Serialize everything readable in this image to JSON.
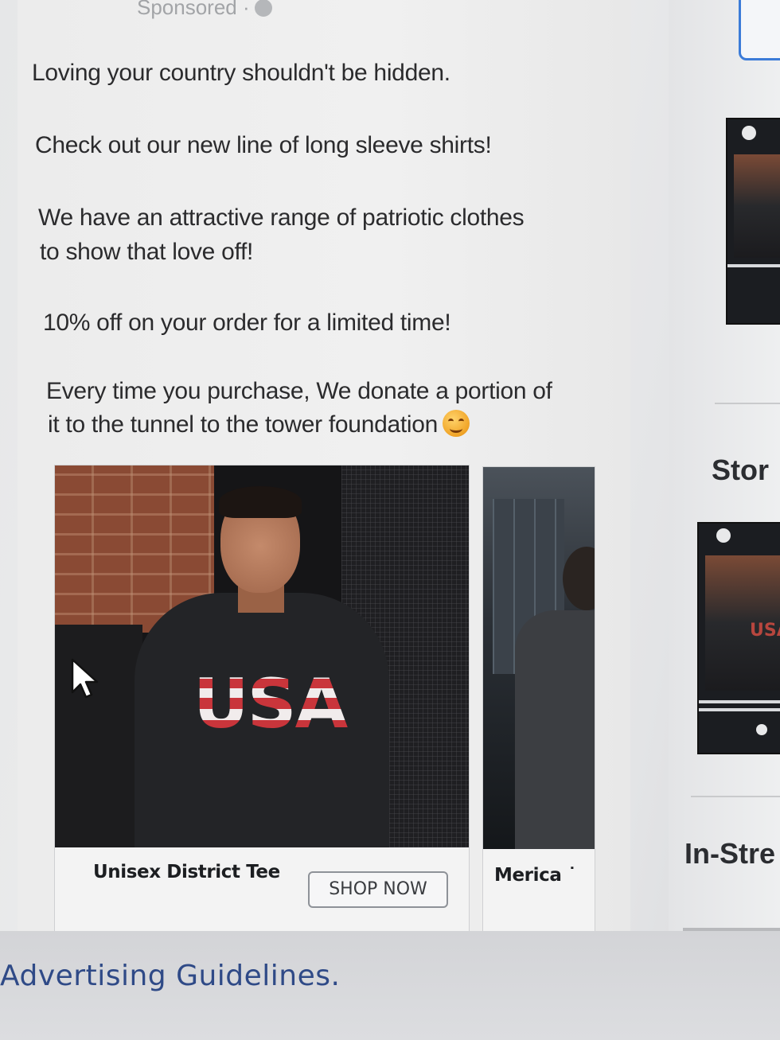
{
  "post": {
    "sponsored_label": "Sponsored · ",
    "lines": [
      "Loving your country shouldn't be hidden.",
      "Check out our new line of long sleeve shirts!",
      "We have an attractive range of patriotic clothes",
      "to show that love off!",
      "10% off on your order for a limited time!",
      "Every time you purchase, We donate a portion of",
      "it to the tunnel to the tower foundation"
    ]
  },
  "carousel": {
    "cards": [
      {
        "title": "Unisex District Tee",
        "cta": "SHOP NOW",
        "print": "USA"
      },
      {
        "title": "Merica ˙"
      }
    ]
  },
  "right_panel": {
    "stories_label": "Stor",
    "instream_label": "In-Stre",
    "thumb_print": "USA"
  },
  "footer": {
    "link": "Advertising Guidelines."
  },
  "colors": {
    "link": "#2f4a87",
    "input_border": "#3b7bd8"
  }
}
